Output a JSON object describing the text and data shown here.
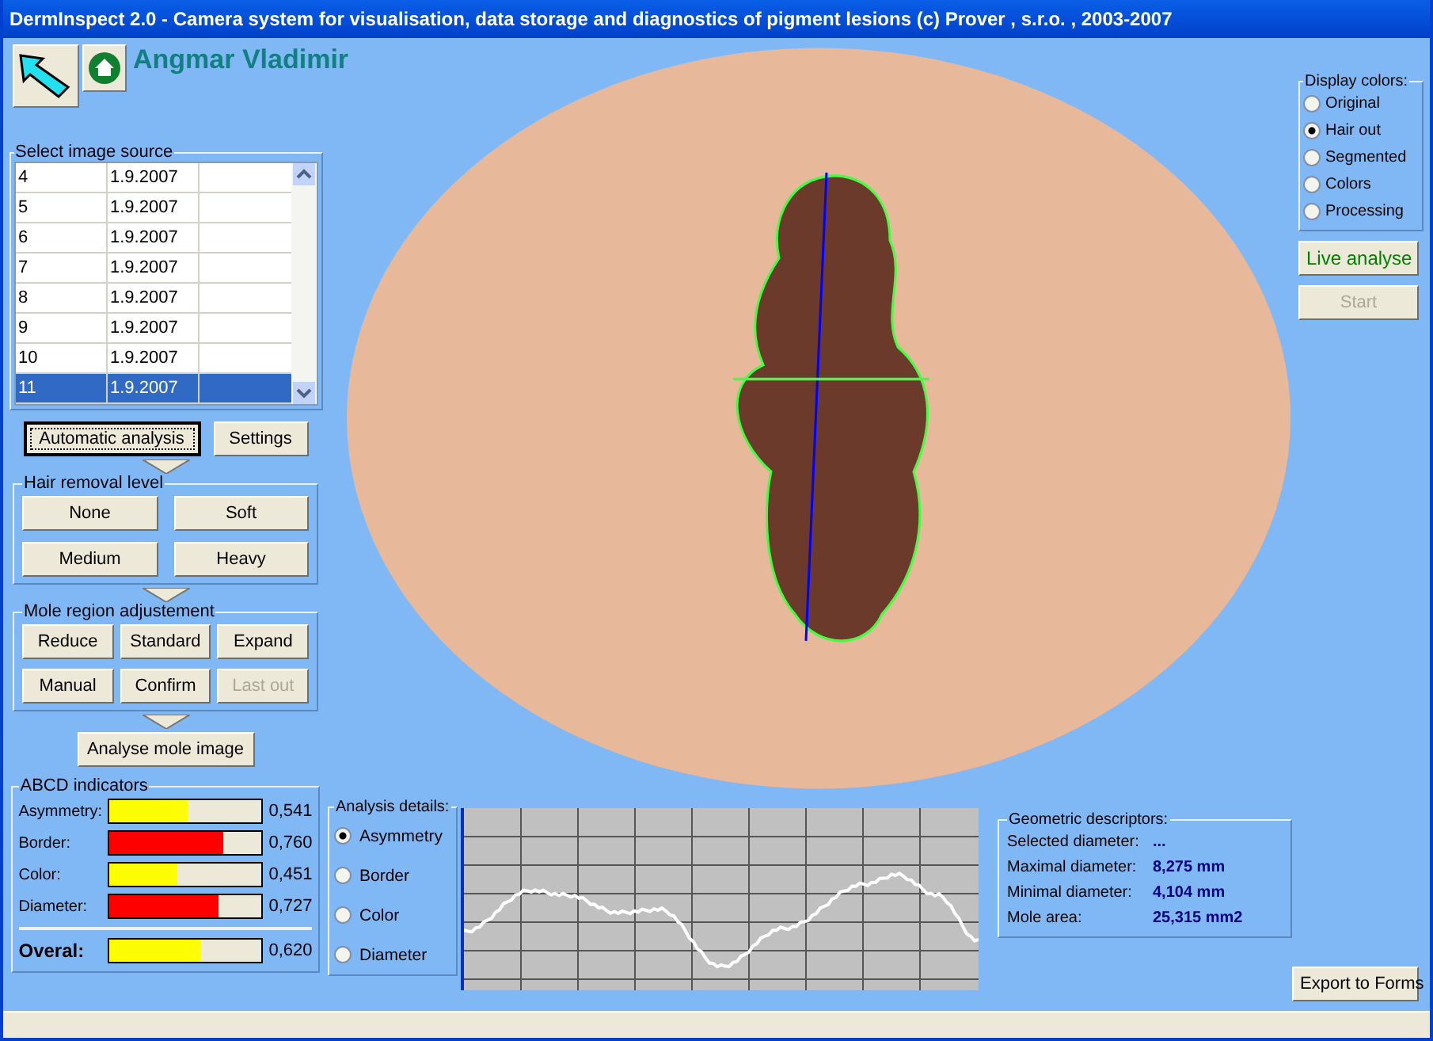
{
  "window": {
    "title": "DermInspect 2.0 - Camera system for visualisation, data storage and diagnostics of pigment lesions (c) Prover , s.r.o. , 2003-2007"
  },
  "patient_name": "Angmar Vladimir",
  "image_source": {
    "label": "Select image source",
    "rows": [
      {
        "cells": [
          "4",
          "1.9.2007"
        ],
        "selected": false
      },
      {
        "cells": [
          "5",
          "1.9.2007"
        ],
        "selected": false
      },
      {
        "cells": [
          "6",
          "1.9.2007"
        ],
        "selected": false
      },
      {
        "cells": [
          "7",
          "1.9.2007"
        ],
        "selected": false
      },
      {
        "cells": [
          "8",
          "1.9.2007"
        ],
        "selected": false
      },
      {
        "cells": [
          "9",
          "1.9.2007"
        ],
        "selected": false
      },
      {
        "cells": [
          "10",
          "1.9.2007"
        ],
        "selected": false
      },
      {
        "cells": [
          "11",
          "1.9.2007"
        ],
        "selected": true
      }
    ]
  },
  "automatic_analysis": "Automatic analysis",
  "settings": "Settings",
  "hair_removal": {
    "label": "Hair removal level",
    "buttons": [
      "None",
      "Soft",
      "Medium",
      "Heavy"
    ]
  },
  "mole_region": {
    "label": "Mole region adjustement",
    "buttons": [
      {
        "label": "Reduce",
        "disabled": false
      },
      {
        "label": "Standard",
        "disabled": false
      },
      {
        "label": "Expand",
        "disabled": false
      },
      {
        "label": "Manual",
        "disabled": false
      },
      {
        "label": "Confirm",
        "disabled": false
      },
      {
        "label": "Last out",
        "disabled": true
      }
    ]
  },
  "analyse_button": "Analyse mole image",
  "abcd": {
    "label": "ABCD indicators",
    "indicators": [
      {
        "name": "Asymmetry:",
        "level": 0.52,
        "color": "#ffff00",
        "reading": "0,541"
      },
      {
        "name": "Border:",
        "level": 0.75,
        "color": "#ff0000",
        "reading": "0,760"
      },
      {
        "name": "Color:",
        "level": 0.45,
        "color": "#ffff00",
        "reading": "0,451"
      },
      {
        "name": "Diameter:",
        "level": 0.72,
        "color": "#ff0000",
        "reading": "0,727"
      }
    ],
    "overall": {
      "name": "Overal:",
      "level": 0.61,
      "color": "#ffff00",
      "reading": "0,620"
    }
  },
  "analysis_details": {
    "label": "Analysis details:",
    "options": [
      {
        "label": "Asymmetry",
        "selected": true
      },
      {
        "label": "Border",
        "selected": false
      },
      {
        "label": "Color",
        "selected": false
      },
      {
        "label": "Diameter",
        "selected": false
      }
    ]
  },
  "geometric": {
    "label": "Geometric descriptors:",
    "rows": [
      {
        "label": "Selected diameter:",
        "value": "..."
      },
      {
        "label": "Maximal diameter:",
        "value": "8,275 mm"
      },
      {
        "label": "Minimal diameter:",
        "value": "4,104 mm"
      },
      {
        "label": "Mole area:",
        "value": "25,315 mm2"
      }
    ]
  },
  "display_colors": {
    "label": "Display colors:",
    "options": [
      {
        "label": "Original",
        "selected": false
      },
      {
        "label": "Hair out",
        "selected": true
      },
      {
        "label": "Segmented",
        "selected": false
      },
      {
        "label": "Colors",
        "selected": false
      },
      {
        "label": "Processing",
        "selected": false
      }
    ]
  },
  "live_analyse": "Live analyse",
  "start": {
    "label": "Start",
    "disabled": true
  },
  "export": "Export to Forms"
}
